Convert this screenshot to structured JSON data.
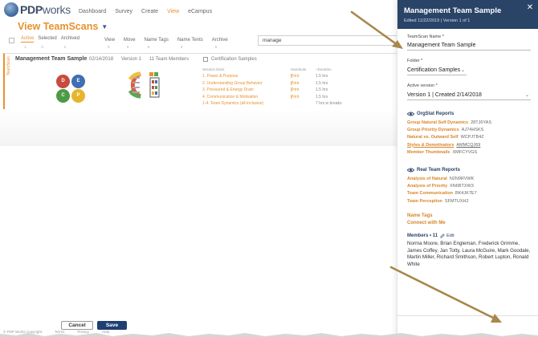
{
  "app": {
    "logo": {
      "brand": "PDP",
      "suffix": "works"
    },
    "nav": [
      "Dashboard",
      "Survey",
      "Create",
      "View",
      "eCampus"
    ],
    "page_title": "View TeamScans",
    "filter_tabs": [
      {
        "label": "Active",
        "count": "1"
      },
      {
        "label": "Selected",
        "count": "0"
      },
      {
        "label": "Archived",
        "count": "2"
      }
    ],
    "actions": [
      {
        "label": "View",
        "count": "0"
      },
      {
        "label": "Move",
        "count": "0"
      },
      {
        "label": "Name Tags",
        "count": "0"
      },
      {
        "label": "Name Tents",
        "count": "0"
      },
      {
        "label": "Archive",
        "count": "0"
      }
    ],
    "search_value": "manage",
    "card": {
      "side_label": "TeamScan",
      "title": "Management Team Sample",
      "date": "02/14/2018",
      "version": "Version 1",
      "members": "11 Team Members",
      "cert_label": "Certification Samples",
      "ohi": [
        "D",
        "E",
        "C",
        "P"
      ],
      "sessions_header": {
        "name": "Session Deck",
        "handouts": "Handouts",
        "duration": "~Duration"
      },
      "sessions": [
        {
          "name": "1. Power & Purpose",
          "print": "Print",
          "duration": "1.5 hrs"
        },
        {
          "name": "2. Understanding Group Behavior",
          "print": "Print",
          "duration": "1.5 hrs"
        },
        {
          "name": "3. Pressured & Energy Drain",
          "print": "Print",
          "duration": "1.5 hrs"
        },
        {
          "name": "4. Communication & Motivation",
          "print": "Print",
          "duration": "1.5 hrs"
        },
        {
          "name": "1-4. Team Dynamics (all-inclusive)",
          "print": "",
          "duration": "7 hrs w breaks"
        }
      ]
    },
    "footer": [
      "© PDP Works Copyright",
      "Terms",
      "Privacy",
      "Help"
    ]
  },
  "panel": {
    "title": "Management Team Sample",
    "subtitle": "Edited 11/22/2019 | Version 1 of 1",
    "name_label": "TeamScan Name *",
    "name_value": "Management Team Sample",
    "folder_label": "Folder *",
    "folder_value": "Certification Samples",
    "version_label": "Active version *",
    "version_value": "Version 1 | Created 2/14/2018",
    "orgstat": {
      "title": "OrgStat Reports",
      "items": [
        {
          "name": "Group Natural Self Dynamics",
          "code": "28TJ6YAS"
        },
        {
          "name": "Group Priority Dynamics",
          "code": "AJ74HSKS"
        },
        {
          "name": "Natural vs. Outward Self",
          "code": "WCPJTB4Z"
        },
        {
          "name": "Styles & Demotivators",
          "code": "AMMCQJ69"
        },
        {
          "name": "Member Thumbnails",
          "code": "XMFCYVGS"
        }
      ]
    },
    "real_team": {
      "title": "Real Team Reports",
      "items": [
        {
          "name": "Analysis of Natural",
          "code": "N2N9RVWK"
        },
        {
          "name": "Analysis of Priority",
          "code": "XN6BTXW3"
        },
        {
          "name": "Team Communication",
          "code": "BK4JK7E7"
        },
        {
          "name": "Team Perception",
          "code": "SFMTUXH2"
        }
      ]
    },
    "name_tags": "Name Tags",
    "connect": "Connect with Me",
    "members_count": "Members • 11",
    "edit": "Edit",
    "members": "Norma Moore, Brian Engleman, Frederick Grimme, James Coffey, Jan Totty, Laura McGuire, Mark Goodale, Martin Miller, Richard Smithson, Robert Lupton, Ronald White",
    "cancel": "Cancel",
    "save": "Save"
  },
  "colors": {
    "accent": "#e8912d",
    "header": "#2a4468",
    "save": "#1f3f73"
  }
}
